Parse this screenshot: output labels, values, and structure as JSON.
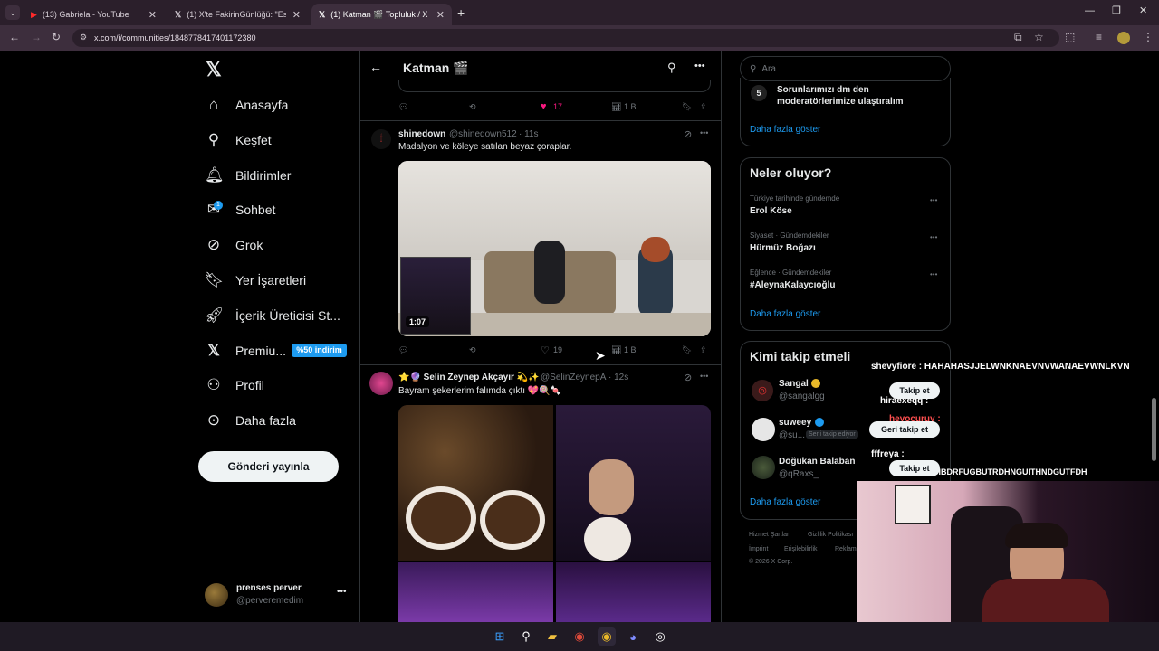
{
  "browser": {
    "tabs": [
      {
        "label": "(13) Gabriela - YouTube"
      },
      {
        "label": "(1) X'te FakirinGünlüğü: \"Eskiler"
      },
      {
        "label": "(1) Katman 🎬 Topluluk / X"
      }
    ],
    "url": "x.com/i/communities/1848778417401172380"
  },
  "nav": {
    "items": [
      {
        "label": "Anasayfa"
      },
      {
        "label": "Keşfet"
      },
      {
        "label": "Bildirimler"
      },
      {
        "label": "Sohbet"
      },
      {
        "label": "Grok"
      },
      {
        "label": "Yer İşaretleri"
      },
      {
        "label": "İçerik Üreticisi St..."
      },
      {
        "label": "Premiu..."
      },
      {
        "label": "Profil"
      },
      {
        "label": "Daha fazla"
      }
    ],
    "chat_badge": "1",
    "premium_badge": "%50 indirim",
    "post_button": "Gönderi yayınla",
    "user": {
      "name": "prenses perver",
      "handle": "@perveremedim"
    }
  },
  "feed": {
    "title": "Katman 🎬",
    "top_actions": {
      "likes": "17",
      "views": "1 B"
    },
    "post1": {
      "name": "shinedown",
      "handle": "@shinedown512",
      "time": "· 11s",
      "text": "Madalyon ve köleye satılan beyaz çoraplar.",
      "video_duration": "1:07",
      "likes": "19",
      "views": "1 B"
    },
    "post2": {
      "name": "⭐🔮 Selin Zeynep Akçayır 💫✨",
      "handle": "@SelinZeynepA",
      "time": "· 12s",
      "text": "Bayram şekerlerim falımda çıktı 💖🍭🍬"
    }
  },
  "right": {
    "search_placeholder": "Ara",
    "rules": {
      "number": "5",
      "text": "Sorunlarımızı dm den moderatörlerimize ulaştıralım",
      "more": "Daha fazla göster"
    },
    "trends": {
      "title": "Neler oluyor?",
      "items": [
        {
          "meta": "Türkiye tarihinde gündemde",
          "name": "Erol Köse"
        },
        {
          "meta": "Siyaset · Gündemdekiler",
          "name": "Hürmüz Boğazı"
        },
        {
          "meta": "Eğlence · Gündemdekiler",
          "name": "#AleynaKalaycıoğlu"
        }
      ],
      "more": "Daha fazla göster"
    },
    "follow": {
      "title": "Kimi takip etmeli",
      "items": [
        {
          "name": "Sangal",
          "handle": "@sangalgg"
        },
        {
          "name": "suweey",
          "handle": "@su...",
          "note": "Seni takip ediyor"
        },
        {
          "name": "Doğukan Balaban",
          "handle": "@qRaxs_"
        }
      ],
      "buttons": [
        "Takip et",
        "Geri takip et",
        "Takip et"
      ],
      "more": "Daha fazla göster"
    },
    "footer": [
      "Hizmet Şartları",
      "Gizlilik Politikası",
      "İmprint",
      "Erişilebilirlik",
      "Reklam",
      "© 2026 X Corp."
    ]
  },
  "overlay": {
    "chat": [
      "shevyfiore : HAHAHASJJELWNKNAEVNVWANAEVWNLKVN",
      "hiraexeqq :",
      "heyocuruy :",
      "fffreya :",
      "BIBDRFUGBUTRDHNGUITHNDGUTFDH"
    ]
  }
}
